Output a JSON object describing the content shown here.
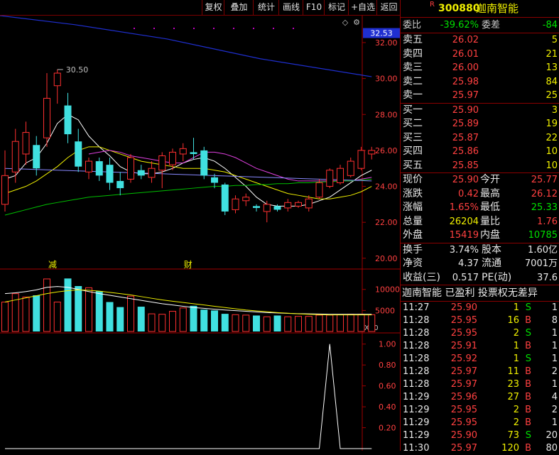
{
  "toolbar": [
    "复权",
    "叠加",
    "统计",
    "画线",
    "F10",
    "标记",
    "+自选",
    "返回"
  ],
  "stock": {
    "badge": "R",
    "code": "300880",
    "name": "迦南智能"
  },
  "order_book": {
    "weibi_label": "委比",
    "weibi": "-39.62%",
    "weicha_label": "委差",
    "weicha": "-84",
    "asks": [
      {
        "label": "卖五",
        "price": "26.02",
        "vol": "5"
      },
      {
        "label": "卖四",
        "price": "26.01",
        "vol": "21"
      },
      {
        "label": "卖三",
        "price": "26.00",
        "vol": "13"
      },
      {
        "label": "卖二",
        "price": "25.98",
        "vol": "84"
      },
      {
        "label": "卖一",
        "price": "25.97",
        "vol": "25"
      }
    ],
    "bids": [
      {
        "label": "买一",
        "price": "25.90",
        "vol": "3"
      },
      {
        "label": "买二",
        "price": "25.89",
        "vol": "19"
      },
      {
        "label": "买三",
        "price": "25.87",
        "vol": "22"
      },
      {
        "label": "买四",
        "price": "25.86",
        "vol": "10"
      },
      {
        "label": "买五",
        "price": "25.85",
        "vol": "10"
      }
    ]
  },
  "quote": [
    {
      "l1": "现价",
      "v1": "25.90",
      "c1": "red",
      "l2": "今开",
      "v2": "25.77",
      "c2": "red"
    },
    {
      "l1": "涨跌",
      "v1": "0.42",
      "c1": "red",
      "l2": "最高",
      "v2": "26.12",
      "c2": "red"
    },
    {
      "l1": "涨幅",
      "v1": "1.65%",
      "c1": "red",
      "l2": "最低",
      "v2": "25.33",
      "c2": "green"
    },
    {
      "l1": "总量",
      "v1": "26204",
      "c1": "yellow",
      "l2": "量比",
      "v2": "1.76",
      "c2": "red"
    },
    {
      "l1": "外盘",
      "v1": "15419",
      "c1": "red",
      "l2": "内盘",
      "v2": "10785",
      "c2": "green"
    }
  ],
  "fundamentals": [
    {
      "l1": "换手",
      "v1": "3.74%",
      "l2": "股本",
      "v2": "1.60亿"
    },
    {
      "l1": "净资",
      "v1": "4.37",
      "l2": "流通",
      "v2": "7001万"
    },
    {
      "l1": "收益(三)",
      "v1": "0.517",
      "l2": "PE(动)",
      "v2": "37.6"
    }
  ],
  "tags": "迦南智能 已盈利 投票权无差异",
  "ticks": [
    {
      "t": "11:27",
      "p": "25.90",
      "v": "1",
      "s": "S",
      "n": "1"
    },
    {
      "t": "11:28",
      "p": "25.95",
      "v": "16",
      "s": "B",
      "n": "8"
    },
    {
      "t": "11:28",
      "p": "25.95",
      "v": "2",
      "s": "S",
      "n": "1"
    },
    {
      "t": "11:28",
      "p": "25.91",
      "v": "1",
      "s": "B",
      "n": "1"
    },
    {
      "t": "11:28",
      "p": "25.92",
      "v": "1",
      "s": "S",
      "n": "1"
    },
    {
      "t": "11:28",
      "p": "25.97",
      "v": "11",
      "s": "B",
      "n": "2"
    },
    {
      "t": "11:28",
      "p": "25.97",
      "v": "23",
      "s": "B",
      "n": "1"
    },
    {
      "t": "11:29",
      "p": "25.96",
      "v": "27",
      "s": "B",
      "n": "4"
    },
    {
      "t": "11:29",
      "p": "25.95",
      "v": "2",
      "s": "B",
      "n": "2"
    },
    {
      "t": "11:29",
      "p": "25.95",
      "v": "2",
      "s": "B",
      "n": "1"
    },
    {
      "t": "11:29",
      "p": "25.90",
      "v": "73",
      "s": "S",
      "n": "20"
    },
    {
      "t": "11:30",
      "p": "25.97",
      "v": "120",
      "s": "B",
      "n": "80"
    }
  ],
  "chart_data": {
    "type": "candlestick",
    "price_axis": {
      "ticks": [
        "32.00",
        "30.00",
        "28.00",
        "26.00",
        "24.00",
        "22.00",
        "20.00"
      ],
      "ylim": [
        19.4,
        33.5
      ],
      "current_label": "32.53"
    },
    "annotations": {
      "high_label": "30.50",
      "marker_1": "减",
      "marker_2": "财"
    },
    "candles": [
      {
        "o": 23.0,
        "c": 24.6,
        "h": 26.0,
        "l": 22.6
      },
      {
        "o": 24.8,
        "c": 26.5,
        "h": 27.2,
        "l": 24.2
      },
      {
        "o": 25.8,
        "c": 27.0,
        "h": 27.6,
        "l": 25.2
      },
      {
        "o": 26.3,
        "c": 25.0,
        "h": 26.8,
        "l": 24.6
      },
      {
        "o": 26.7,
        "c": 28.9,
        "h": 30.3,
        "l": 26.2
      },
      {
        "o": 29.6,
        "c": 30.3,
        "h": 30.5,
        "l": 28.6
      },
      {
        "o": 28.5,
        "c": 26.9,
        "h": 29.2,
        "l": 26.4
      },
      {
        "o": 26.5,
        "c": 25.1,
        "h": 27.2,
        "l": 24.8
      },
      {
        "o": 24.8,
        "c": 25.4,
        "h": 25.6,
        "l": 24.4
      },
      {
        "o": 25.4,
        "c": 24.6,
        "h": 25.6,
        "l": 24.3
      },
      {
        "o": 25.2,
        "c": 24.2,
        "h": 25.6,
        "l": 23.8
      },
      {
        "o": 24.3,
        "c": 23.9,
        "h": 24.8,
        "l": 23.5
      },
      {
        "o": 24.4,
        "c": 25.6,
        "h": 25.8,
        "l": 24.2
      },
      {
        "o": 24.9,
        "c": 24.6,
        "h": 25.2,
        "l": 24.4
      },
      {
        "o": 24.5,
        "c": 25.0,
        "h": 25.4,
        "l": 24.2
      },
      {
        "o": 24.9,
        "c": 25.7,
        "h": 25.9,
        "l": 23.9
      },
      {
        "o": 25.2,
        "c": 25.9,
        "h": 26.1,
        "l": 24.9
      },
      {
        "o": 25.8,
        "c": 26.1,
        "h": 26.4,
        "l": 25.4
      },
      {
        "o": 25.9,
        "c": 25.8,
        "h": 26.7,
        "l": 25.5
      },
      {
        "o": 26.0,
        "c": 24.6,
        "h": 26.2,
        "l": 24.4
      },
      {
        "o": 24.5,
        "c": 24.2,
        "h": 24.7,
        "l": 23.9
      },
      {
        "o": 24.1,
        "c": 22.6,
        "h": 24.2,
        "l": 22.4
      },
      {
        "o": 22.7,
        "c": 23.3,
        "h": 23.5,
        "l": 22.5
      },
      {
        "o": 23.2,
        "c": 23.4,
        "h": 23.6,
        "l": 22.9
      },
      {
        "o": 22.9,
        "c": 22.8,
        "h": 23.0,
        "l": 22.6
      },
      {
        "o": 22.6,
        "c": 23.0,
        "h": 23.2,
        "l": 22.0
      },
      {
        "o": 22.9,
        "c": 22.7,
        "h": 23.0,
        "l": 22.6
      },
      {
        "o": 22.8,
        "c": 23.1,
        "h": 23.3,
        "l": 22.6
      },
      {
        "o": 22.9,
        "c": 23.1,
        "h": 23.2,
        "l": 22.8
      },
      {
        "o": 22.8,
        "c": 23.3,
        "h": 23.5,
        "l": 22.6
      },
      {
        "o": 23.4,
        "c": 24.2,
        "h": 24.4,
        "l": 23.3
      },
      {
        "o": 24.0,
        "c": 24.9,
        "h": 25.0,
        "l": 23.9
      },
      {
        "o": 24.2,
        "c": 25.0,
        "h": 25.2,
        "l": 24.1
      },
      {
        "o": 24.6,
        "c": 25.4,
        "h": 25.6,
        "l": 24.5
      },
      {
        "o": 25.0,
        "c": 26.0,
        "h": 26.2,
        "l": 24.9
      },
      {
        "o": 25.8,
        "c": 26.0,
        "h": 26.2,
        "l": 25.5
      }
    ],
    "ma_lines": [
      {
        "color": "#ffffff",
        "values": [
          24.4,
          24.6,
          25.3,
          25.6,
          26.4,
          27.5,
          28.0,
          27.7,
          26.8,
          26.2,
          25.7,
          25.1,
          24.8,
          24.7,
          24.7,
          24.8,
          25.0,
          25.3,
          25.5,
          25.6,
          25.4,
          25.0,
          24.5,
          24.0,
          23.4,
          23.0,
          22.9,
          22.9,
          22.9,
          23.0,
          23.2,
          23.4,
          23.8,
          24.2,
          24.6,
          24.9
        ]
      },
      {
        "color": "#f0f000",
        "values": [
          23.6,
          23.8,
          24.0,
          24.3,
          24.7,
          25.1,
          25.6,
          26.0,
          26.2,
          26.2,
          26.0,
          25.8,
          25.6,
          25.4,
          25.3,
          25.2,
          25.1,
          25.0,
          25.0,
          25.0,
          24.9,
          24.8,
          24.6,
          24.4,
          24.2,
          24.0,
          23.8,
          23.6,
          23.5,
          23.4,
          23.3,
          23.3,
          23.4,
          23.5,
          23.7,
          24.0
        ]
      },
      {
        "color": "#e040e0",
        "values": [
          null,
          null,
          null,
          null,
          null,
          null,
          null,
          null,
          25.8,
          25.9,
          26.0,
          25.9,
          25.7,
          25.6,
          25.5,
          25.4,
          25.3,
          25.3,
          25.6,
          25.9,
          25.9,
          25.8,
          25.6,
          25.3,
          25.0,
          24.8,
          24.6,
          24.4,
          24.3,
          24.3,
          24.3,
          24.3,
          24.3,
          24.3,
          24.4,
          24.5
        ]
      },
      {
        "color": "#00c000",
        "values": [
          22.4,
          22.55,
          22.7,
          22.85,
          23.0,
          23.1,
          23.2,
          23.3,
          23.4,
          23.45,
          23.5,
          23.55,
          23.6,
          23.65,
          23.7,
          23.75,
          23.8,
          23.85,
          23.9,
          23.95,
          24.0,
          24.0,
          24.05,
          24.05,
          24.1,
          24.1,
          24.15,
          24.15,
          24.2,
          24.2,
          24.25,
          24.25,
          24.3,
          24.3,
          24.35,
          24.4
        ]
      },
      {
        "color": "#8888ff",
        "values": [
          25.0,
          24.98,
          24.96,
          24.94,
          24.92,
          24.9,
          24.88,
          24.86,
          24.84,
          24.82,
          24.8,
          24.78,
          24.76,
          24.74,
          24.72,
          24.7,
          24.68,
          24.66,
          24.64,
          24.62,
          24.6,
          24.58,
          24.56,
          24.54,
          24.52,
          24.5,
          24.48,
          24.46,
          24.44,
          24.42,
          24.4,
          24.38,
          24.36,
          24.34,
          24.32,
          24.3
        ]
      }
    ],
    "long_ma_line": {
      "color": "#1f2fd0",
      "x": [
        0,
        0.2,
        0.45,
        0.7,
        1.0
      ],
      "values": [
        33.5,
        33.0,
        32.2,
        31.1,
        30.1
      ]
    },
    "volume": {
      "ticks": [
        "10000",
        "5000"
      ],
      "unit_label": "X10",
      "ylim": [
        0,
        13500
      ],
      "values": [
        7000,
        9000,
        8200,
        8600,
        12500,
        7000,
        12600,
        10800,
        10400,
        9600,
        7000,
        5800,
        8400,
        5900,
        4200,
        4100,
        4800,
        5600,
        6100,
        5200,
        5000,
        4200,
        4000,
        3900,
        3800,
        3500,
        3800,
        3500,
        3600,
        3600,
        3900,
        3900,
        4000,
        4100,
        4100,
        4000
      ],
      "ma_white": [
        9000,
        9200,
        9500,
        9900,
        10500,
        10700,
        10500,
        10000,
        9500,
        9000,
        8600,
        8200,
        7800,
        7400,
        7000,
        6600,
        6300,
        6000,
        5700,
        5500,
        5300,
        5100,
        4950,
        4800,
        4650,
        4500,
        4400,
        4300,
        4250,
        4200,
        4150,
        4100,
        4100,
        4100,
        4100,
        4100
      ],
      "ma_yellow": [
        7000,
        7500,
        8000,
        8500,
        9000,
        9400,
        9700,
        9900,
        9800,
        9600,
        9300,
        9000,
        8700,
        8300,
        7900,
        7500,
        7200,
        6900,
        6600,
        6300,
        6000,
        5700,
        5400,
        5100,
        4900,
        4700,
        4500,
        4350,
        4200,
        4100,
        4000,
        3950,
        3950,
        3950,
        3950,
        3950
      ]
    },
    "indicator": {
      "ticks": [
        "1.00",
        "0.80",
        "0.60",
        "0.40",
        "0.20"
      ],
      "ylim": [
        0,
        1.1
      ],
      "values": [
        0,
        0,
        0,
        0,
        0,
        0,
        0,
        0,
        0,
        0,
        0,
        0,
        0,
        0,
        0,
        0,
        0,
        0,
        0,
        0,
        0,
        0,
        0,
        0,
        0,
        0,
        0,
        0,
        0,
        0,
        0,
        1.0,
        0,
        0,
        0,
        0
      ]
    }
  }
}
